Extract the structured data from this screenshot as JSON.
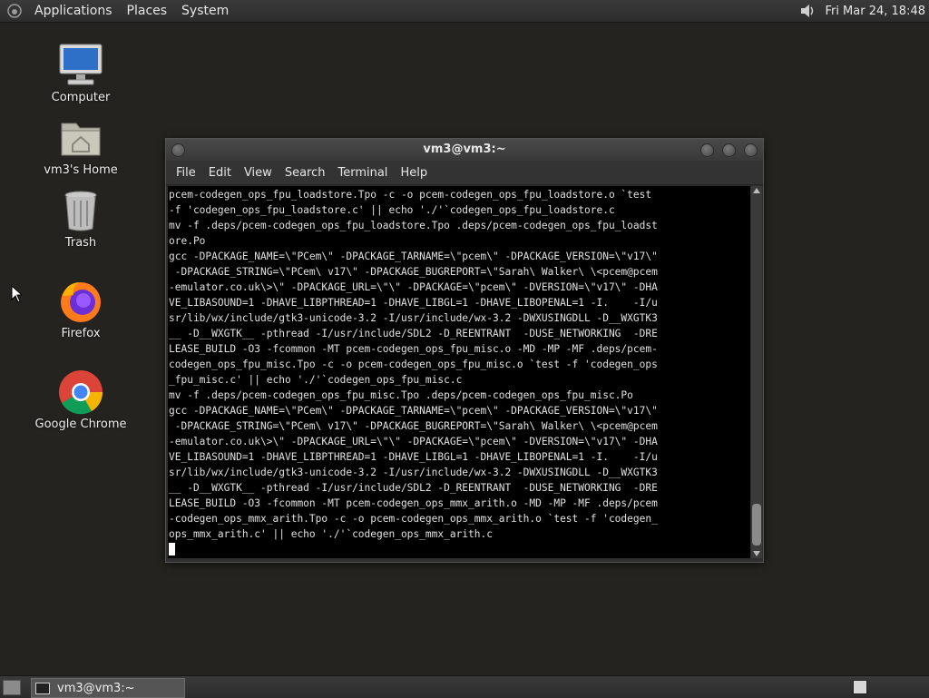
{
  "top_panel": {
    "menus": [
      "Applications",
      "Places",
      "System"
    ],
    "clock": "Fri Mar 24, 18:48",
    "icons": [
      "gnome-foot-icon",
      "volume-icon"
    ]
  },
  "desktop_icons": [
    {
      "label": "Computer",
      "icon": "computer-icon"
    },
    {
      "label": "vm3's Home",
      "icon": "home-folder-icon"
    },
    {
      "label": "Trash",
      "icon": "trash-icon"
    },
    {
      "label": "Firefox",
      "icon": "firefox-icon"
    },
    {
      "label": "Google Chrome",
      "icon": "chrome-icon"
    }
  ],
  "terminal": {
    "title": "vm3@vm3:~",
    "menus": [
      "File",
      "Edit",
      "View",
      "Search",
      "Terminal",
      "Help"
    ],
    "lines": [
      "pcem-codegen_ops_fpu_loadstore.Tpo -c -o pcem-codegen_ops_fpu_loadstore.o `test",
      "-f 'codegen_ops_fpu_loadstore.c' || echo './'`codegen_ops_fpu_loadstore.c",
      "mv -f .deps/pcem-codegen_ops_fpu_loadstore.Tpo .deps/pcem-codegen_ops_fpu_loadst",
      "ore.Po",
      "gcc -DPACKAGE_NAME=\\\"PCem\\\" -DPACKAGE_TARNAME=\\\"pcem\\\" -DPACKAGE_VERSION=\\\"v17\\\"",
      " -DPACKAGE_STRING=\\\"PCem\\ v17\\\" -DPACKAGE_BUGREPORT=\\\"Sarah\\ Walker\\ \\<pcem@pcem",
      "-emulator.co.uk\\>\\\" -DPACKAGE_URL=\\\"\\\" -DPACKAGE=\\\"pcem\\\" -DVERSION=\\\"v17\\\" -DHA",
      "VE_LIBASOUND=1 -DHAVE_LIBPTHREAD=1 -DHAVE_LIBGL=1 -DHAVE_LIBOPENAL=1 -I.    -I/u",
      "sr/lib/wx/include/gtk3-unicode-3.2 -I/usr/include/wx-3.2 -DWXUSINGDLL -D__WXGTK3",
      "__ -D__WXGTK__ -pthread -I/usr/include/SDL2 -D_REENTRANT  -DUSE_NETWORKING  -DRE",
      "LEASE_BUILD -O3 -fcommon -MT pcem-codegen_ops_fpu_misc.o -MD -MP -MF .deps/pcem-",
      "codegen_ops_fpu_misc.Tpo -c -o pcem-codegen_ops_fpu_misc.o `test -f 'codegen_ops",
      "_fpu_misc.c' || echo './'`codegen_ops_fpu_misc.c",
      "mv -f .deps/pcem-codegen_ops_fpu_misc.Tpo .deps/pcem-codegen_ops_fpu_misc.Po",
      "gcc -DPACKAGE_NAME=\\\"PCem\\\" -DPACKAGE_TARNAME=\\\"pcem\\\" -DPACKAGE_VERSION=\\\"v17\\\"",
      " -DPACKAGE_STRING=\\\"PCem\\ v17\\\" -DPACKAGE_BUGREPORT=\\\"Sarah\\ Walker\\ \\<pcem@pcem",
      "-emulator.co.uk\\>\\\" -DPACKAGE_URL=\\\"\\\" -DPACKAGE=\\\"pcem\\\" -DVERSION=\\\"v17\\\" -DHA",
      "VE_LIBASOUND=1 -DHAVE_LIBPTHREAD=1 -DHAVE_LIBGL=1 -DHAVE_LIBOPENAL=1 -I.    -I/u",
      "sr/lib/wx/include/gtk3-unicode-3.2 -I/usr/include/wx-3.2 -DWXUSINGDLL -D__WXGTK3",
      "__ -D__WXGTK__ -pthread -I/usr/include/SDL2 -D_REENTRANT  -DUSE_NETWORKING  -DRE",
      "LEASE_BUILD -O3 -fcommon -MT pcem-codegen_ops_mmx_arith.o -MD -MP -MF .deps/pcem",
      "-codegen_ops_mmx_arith.Tpo -c -o pcem-codegen_ops_mmx_arith.o `test -f 'codegen_",
      "ops_mmx_arith.c' || echo './'`codegen_ops_mmx_arith.c"
    ]
  },
  "bottom_panel": {
    "task_label": "vm3@vm3:~"
  }
}
